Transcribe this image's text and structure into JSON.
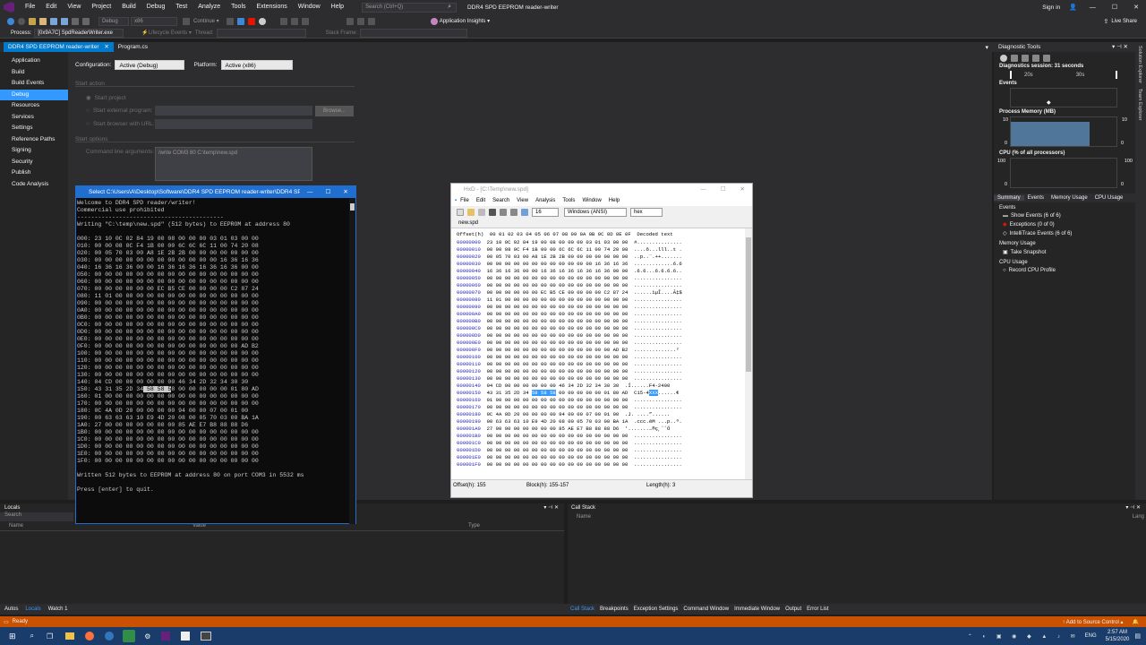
{
  "menu": [
    "File",
    "Edit",
    "View",
    "Project",
    "Build",
    "Debug",
    "Test",
    "Analyze",
    "Tools",
    "Extensions",
    "Window",
    "Help"
  ],
  "search": {
    "placeholder": "Search (Ctrl+Q)"
  },
  "window_title": "DDR4 SPD EEPROM reader-writer",
  "sign_in": "Sign in",
  "toolbar": {
    "debug": "Debug",
    "platform": "x86",
    "continue": "Continue ▾",
    "app_insights": "Application Insights ▾",
    "live_share": "Live Share"
  },
  "toolbar2": {
    "process_label": "Process:",
    "process": "[0x9A7C] SpdReaderWriter.exe",
    "lifecycle": "Lifecycle Events ▾",
    "thread": "Thread:",
    "stackframe": "Stack Frame:"
  },
  "doctabs": [
    "DDR4 SPD EEPROM reader-writer",
    "Program.cs"
  ],
  "props": {
    "items": [
      "Application",
      "Build",
      "Build Events",
      "Debug",
      "Resources",
      "Services",
      "Settings",
      "Reference Paths",
      "Signing",
      "Security",
      "Publish",
      "Code Analysis"
    ],
    "config_label": "Configuration:",
    "config": "Active (Debug)",
    "platform_label": "Platform:",
    "platform": "Active (x86)",
    "start_action": "Start action",
    "start_project": "Start project",
    "start_external": "Start external program:",
    "browse": "Browse...",
    "start_browser": "Start browser with URL:",
    "start_options": "Start options",
    "cmd_label": "Command line arguments:",
    "cmd": "/write COM3 80 C:\\temp\\new.spd"
  },
  "diag": {
    "title": "Diagnostic Tools",
    "session": "Diagnostics session: 31 seconds",
    "t1": "20s",
    "t2": "30s",
    "events": "Events",
    "mem": "Process Memory (MB)",
    "mem_max": "10",
    "mem_min": "0",
    "cpu": "CPU (% of all processors)",
    "cpu_max": "100",
    "cpu_min": "0",
    "tabs": [
      "Summary",
      "Events",
      "Memory Usage",
      "CPU Usage"
    ],
    "ev_hdr": "Events",
    "show_events": "Show Events (6 of 6)",
    "exceptions": "Exceptions (0 of 0)",
    "intellitrace": "IntelliTrace Events (6 of 6)",
    "mu_hdr": "Memory Usage",
    "snapshot": "Take Snapshot",
    "cpu_hdr": "CPU Usage",
    "record": "Record CPU Profile",
    "side_tabs": [
      "Solution Explorer",
      "Team Explorer"
    ]
  },
  "locals": {
    "title": "Locals",
    "search": "Search",
    "cols": [
      "Name",
      "Value",
      "Type"
    ]
  },
  "callstack": {
    "title": "Call Stack",
    "cols": [
      "Name",
      "Lang"
    ]
  },
  "bottom_tabs_left": [
    "Autos",
    "Locals",
    "Watch 1"
  ],
  "bottom_tabs_right": [
    "Call Stack",
    "Breakpoints",
    "Exception Settings",
    "Command Window",
    "Immediate Window",
    "Output",
    "Error List"
  ],
  "status": {
    "ready": "Ready",
    "source": "↑ Add to Source Control ▴"
  },
  "taskbar": {
    "mem": "169 MB",
    "time": "2:57 AM",
    "date": "5/15/2020",
    "lang": "ENG"
  },
  "console": {
    "title": "Select C:\\Users\\A\\Desktop\\Software\\DDR4 SPD EEPROM reader-writer\\DDR4 SPD EE...",
    "lines": [
      "Welcome to DDR4 SPD reader/writer!",
      "Commercial use prohibited",
      "------------------------------------------",
      "Writing \"C:\\temp\\new.spd\" (512 bytes) to EEPROM at address 80",
      "",
      "000: 23 10 0C 02 84 19 00 08 00 00 00 03 01 03 00 00",
      "010: 00 00 08 0C F4 1B 00 00 6C 6C 6C 11 00 74 20 08",
      "020: 00 05 70 03 00 A8 1E 2B 2B 00 00 00 00 00 00 00",
      "030: 00 00 00 00 00 00 00 00 00 00 00 00 16 36 16 36",
      "040: 16 36 16 36 00 00 16 36 16 36 16 36 16 36 00 00",
      "050: 00 00 00 00 00 00 00 00 00 00 00 00 00 00 00 00",
      "060: 00 00 00 00 00 00 00 00 00 00 00 00 00 00 00 00",
      "070: 00 00 00 00 00 00 EC B5 CE 00 00 00 00 C2 87 24",
      "080: 11 01 00 00 00 00 00 00 00 00 00 00 00 00 00 00",
      "090: 00 00 00 00 00 00 00 00 00 00 00 00 00 00 00 00",
      "0A0: 00 00 00 00 00 00 00 00 00 00 00 00 00 00 00 00",
      "0B0: 00 00 00 00 00 00 00 00 00 00 00 00 00 00 00 00",
      "0C0: 00 00 00 00 00 00 00 00 00 00 00 00 00 00 00 00",
      "0D0: 00 00 00 00 00 00 00 00 00 00 00 00 00 00 00 00",
      "0E0: 00 00 00 00 00 00 00 00 00 00 00 00 00 00 00 00",
      "0F0: 00 00 00 00 00 00 00 00 00 00 00 00 00 00 AD B2",
      "100: 00 00 00 00 00 00 00 00 00 00 00 00 00 00 00 00",
      "110: 00 00 00 00 00 00 00 00 00 00 00 00 00 00 00 00",
      "120: 00 00 00 00 00 00 00 00 00 00 00 00 00 00 00 00",
      "130: 00 00 00 00 00 00 00 00 00 00 00 00 00 00 00 00",
      "140: 04 CD 00 00 00 00 00 00 46 34 2D 32 34 30 30",
      "150: 43 31 35 2D 34 58 58 58 00 00 00 00 00 01 80 AD",
      "160: 01 00 00 00 00 00 00 00 00 00 00 00 00 00 00 00",
      "170: 00 00 00 00 00 00 00 00 00 00 00 00 00 00 00 00",
      "180: 0C 4A 0D 20 00 00 00 00 94 00 00 07 00 01 00",
      "190: 00 63 63 63 10 E9 4D 20 08 00 05 70 03 00 BA 1A",
      "1A0: 27 00 00 00 00 00 00 00 85 AE E7 B8 88 88 D6",
      "1B0: 00 00 00 00 00 00 00 00 00 00 00 00 00 00 00 00",
      "1C0: 00 00 00 00 00 00 00 00 00 00 00 00 00 00 00 00",
      "1D0: 00 00 00 00 00 00 00 00 00 00 00 00 00 00 00 00",
      "1E0: 00 00 00 00 00 00 00 00 00 00 00 00 00 00 00 00",
      "1F0: 00 00 00 00 00 00 00 00 00 00 00 00 00 00 00 00",
      "",
      "Written 512 bytes to EEPROM at address 80 on port COM3 in 5532 ms",
      "",
      "Press [enter] to quit."
    ]
  },
  "hxd": {
    "title": "HxD - [C:\\Temp\\new.spd]",
    "menu": [
      "File",
      "Edit",
      "Search",
      "View",
      "Analysis",
      "Tools",
      "Window",
      "Help"
    ],
    "cols": "16",
    "charset": "Windows (ANSI)",
    "base": "hex",
    "tab": "new.spd",
    "header": "Offset(h)  00 01 02 03 04 05 06 07 08 09 0A 0B 0C 0D 0E 0F  Decoded text",
    "status": {
      "offset": "Offset(h): 155",
      "block": "Block(h): 155-157",
      "length": "Length(h): 3"
    },
    "rows": [
      [
        "00000000",
        "23 10 0C 02 84 19 00 08 00 00 00 03 01 03 00 00",
        "#..............."
      ],
      [
        "00000010",
        "00 00 08 0C F4 1B 00 00 6C 6C 6C 11 00 74 20 08",
        "....ô...lll..t ."
      ],
      [
        "00000020",
        "00 05 70 03 00 A8 1E 2B 2B 00 00 00 00 00 00 00",
        "..p..¨.++......."
      ],
      [
        "00000030",
        "00 00 00 00 00 00 00 00 00 00 00 00 16 36 16 36",
        ".............6.6"
      ],
      [
        "00000040",
        "16 36 16 36 00 00 16 36 16 36 16 36 16 36 00 00",
        ".6.6...6.6.6.6.."
      ],
      [
        "00000050",
        "00 00 00 00 00 00 00 00 00 00 00 00 00 00 00 00",
        "................"
      ],
      [
        "00000060",
        "00 00 00 00 00 00 00 00 00 00 00 00 00 00 00 00",
        "................"
      ],
      [
        "00000070",
        "00 00 00 00 00 00 EC B5 CE 00 00 00 00 C2 87 24",
        "......ìµÎ....Â‡$"
      ],
      [
        "00000080",
        "11 01 00 00 00 00 00 00 00 00 00 00 00 00 00 00",
        "................"
      ],
      [
        "00000090",
        "00 00 00 00 00 00 00 00 00 00 00 00 00 00 00 00",
        "................"
      ],
      [
        "000000A0",
        "00 00 00 00 00 00 00 00 00 00 00 00 00 00 00 00",
        "................"
      ],
      [
        "000000B0",
        "00 00 00 00 00 00 00 00 00 00 00 00 00 00 00 00",
        "................"
      ],
      [
        "000000C0",
        "00 00 00 00 00 00 00 00 00 00 00 00 00 00 00 00",
        "................"
      ],
      [
        "000000D0",
        "00 00 00 00 00 00 00 00 00 00 00 00 00 00 00 00",
        "................"
      ],
      [
        "000000E0",
        "00 00 00 00 00 00 00 00 00 00 00 00 00 00 00 00",
        "................"
      ],
      [
        "000000F0",
        "00 00 00 00 00 00 00 00 00 00 00 00 00 00 AD B2",
        "..............­²"
      ],
      [
        "00000100",
        "00 00 00 00 00 00 00 00 00 00 00 00 00 00 00 00",
        "................"
      ],
      [
        "00000110",
        "00 00 00 00 00 00 00 00 00 00 00 00 00 00 00 00",
        "................"
      ],
      [
        "00000120",
        "00 00 00 00 00 00 00 00 00 00 00 00 00 00 00 00",
        "................"
      ],
      [
        "00000130",
        "00 00 00 00 00 00 00 00 00 00 00 00 00 00 00 00",
        "................"
      ],
      [
        "00000140",
        "04 CD 00 00 00 00 00 00 46 34 2D 32 34 30 30",
        ".Í......F4-2400"
      ],
      [
        "00000150",
        "43 31 35 2D 34 58 58 58 00 00 00 00 00 01 80 AD",
        "C15-4XXX......€­"
      ],
      [
        "00000160",
        "01 00 00 00 00 00 00 00 00 00 00 00 00 00 00 00",
        "................"
      ],
      [
        "00000170",
        "00 00 00 00 00 00 00 00 00 00 00 00 00 00 00 00",
        "................"
      ],
      [
        "00000180",
        "0C 4A 0D 20 00 00 00 00 94 00 00 07 00 01 00",
        ".J. ....”......"
      ],
      [
        "00000190",
        "00 63 63 63 10 E9 4D 20 08 00 05 70 03 00 BA 1A",
        ".ccc.éM ...p..º."
      ],
      [
        "000001A0",
        "27 00 00 00 00 00 00 00 85 AE E7 B8 88 88 D6",
        "'.......…®ç¸ˆˆÖ"
      ],
      [
        "000001B0",
        "00 00 00 00 00 00 00 00 00 00 00 00 00 00 00 00",
        "................"
      ],
      [
        "000001C0",
        "00 00 00 00 00 00 00 00 00 00 00 00 00 00 00 00",
        "................"
      ],
      [
        "000001D0",
        "00 00 00 00 00 00 00 00 00 00 00 00 00 00 00 00",
        "................"
      ],
      [
        "000001E0",
        "00 00 00 00 00 00 00 00 00 00 00 00 00 00 00 00",
        "................"
      ],
      [
        "000001F0",
        "00 00 00 00 00 00 00 00 00 00 00 00 00 00 00 00",
        "................"
      ]
    ]
  }
}
